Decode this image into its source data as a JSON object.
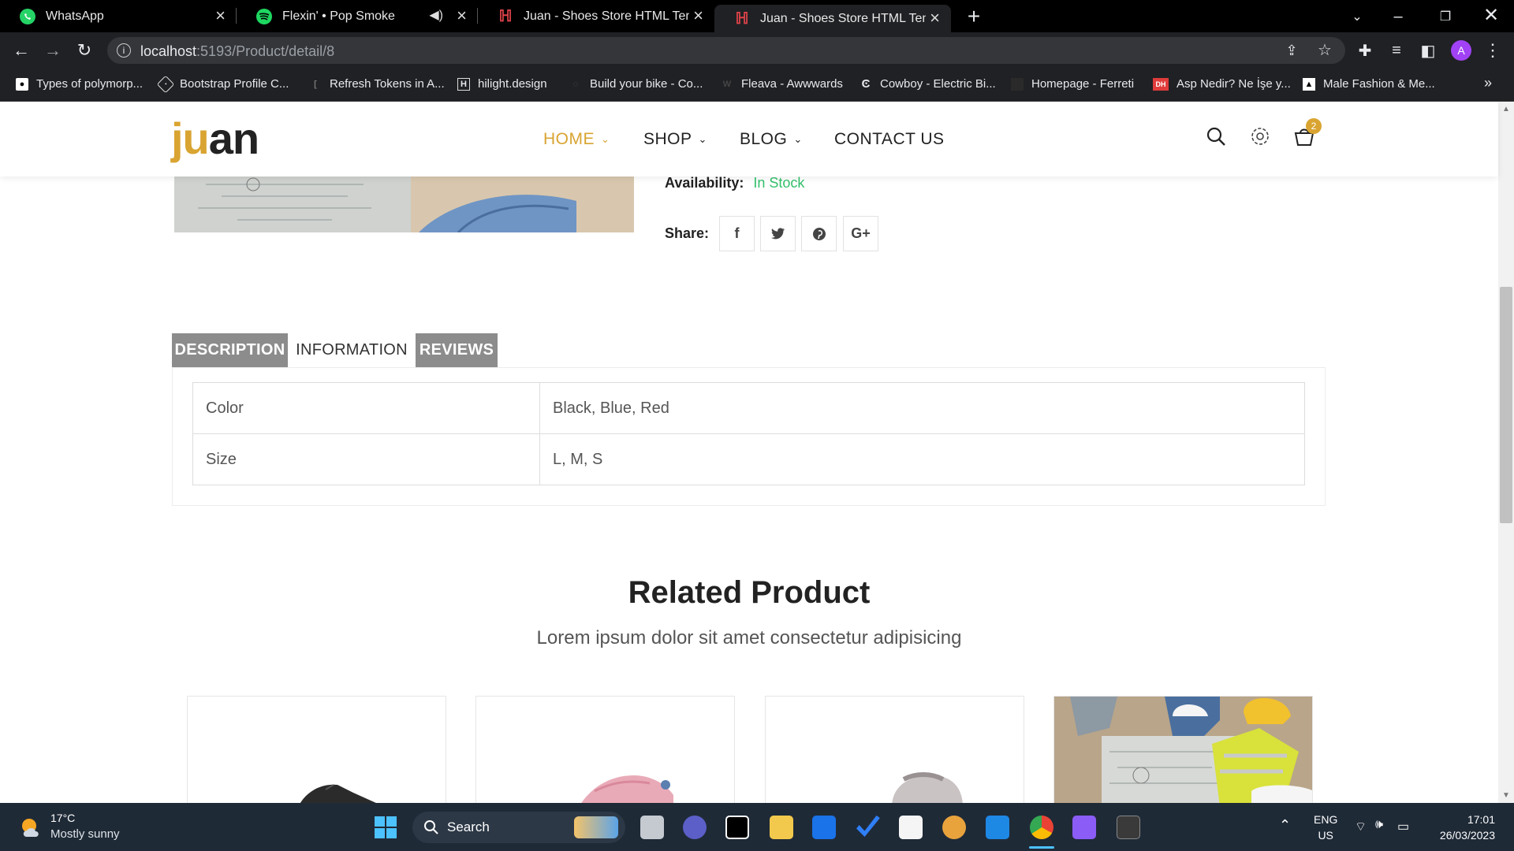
{
  "browser": {
    "tabs": [
      {
        "title": "WhatsApp",
        "active": false
      },
      {
        "title": "Flexin' • Pop Smoke",
        "active": false
      },
      {
        "title": "Juan - Shoes Store HTML Templa",
        "active": false
      },
      {
        "title": "Juan - Shoes Store HTML Templa",
        "active": true
      }
    ],
    "url_host": "localhost",
    "url_path": ":5193/Product/detail/8",
    "profile_initial": "A",
    "bookmarks": [
      "Types of polymorp...",
      "Bootstrap Profile C...",
      "Refresh Tokens in A...",
      "hilight.design",
      "Build your bike - Co...",
      "Fleava - Awwwards",
      "Cowboy - Electric Bi...",
      "Homepage - Ferreti",
      "Asp Nedir? Ne İşe y...",
      "Male Fashion & Me..."
    ],
    "bookmarks_overflow": "»"
  },
  "site": {
    "logo_part1": "ju",
    "logo_part2": "an",
    "nav": [
      {
        "label": "HOME",
        "dropdown": true,
        "current": true
      },
      {
        "label": "SHOP",
        "dropdown": true,
        "current": false
      },
      {
        "label": "BLOG",
        "dropdown": true,
        "current": false
      },
      {
        "label": "CONTACT US",
        "dropdown": false,
        "current": false
      }
    ],
    "cart_count": "2",
    "accent_color": "#d9a431"
  },
  "product": {
    "availability_label": "Availability:",
    "availability_value": "In Stock",
    "share_label": "Share:",
    "share_buttons": [
      "f",
      "t",
      "p",
      "G+"
    ],
    "tabs": [
      {
        "label": "DESCRIPTION",
        "active": false
      },
      {
        "label": "INFORMATION",
        "active": true
      },
      {
        "label": "REVIEWS",
        "active": false
      }
    ],
    "info": [
      {
        "key": "Color",
        "value": "Black, Blue, Red"
      },
      {
        "key": "Size",
        "value": "L, M, S"
      }
    ]
  },
  "related": {
    "title": "Related Product",
    "subtitle": "Lorem ipsum dolor sit amet consectetur adipisicing"
  },
  "taskbar": {
    "weather_temp": "17°C",
    "weather_desc": "Mostly sunny",
    "search_label": "Search",
    "lang_top": "ENG",
    "lang_bottom": "US",
    "time": "17:01",
    "date": "26/03/2023"
  }
}
